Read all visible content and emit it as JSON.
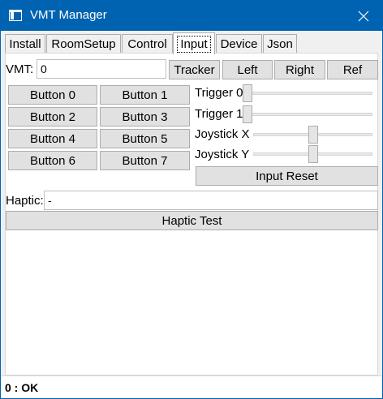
{
  "window": {
    "title": "VMT Manager"
  },
  "tabs": [
    {
      "label": "Install"
    },
    {
      "label": "RoomSetup"
    },
    {
      "label": "Control"
    },
    {
      "label": "Input"
    },
    {
      "label": "Device"
    },
    {
      "label": "Json"
    }
  ],
  "active_tab": "Input",
  "input": {
    "vmt_label": "VMT:",
    "vmt_value": "0",
    "mode_buttons": [
      "Tracker",
      "Left",
      "Right",
      "Ref"
    ],
    "buttons": [
      "Button 0",
      "Button 1",
      "Button 2",
      "Button 3",
      "Button 4",
      "Button 5",
      "Button 6",
      "Button 7"
    ],
    "sliders": [
      {
        "label": "Trigger 0",
        "value": 0.0
      },
      {
        "label": "Trigger 1",
        "value": 0.0
      },
      {
        "label": "Joystick X",
        "value": 0.5
      },
      {
        "label": "Joystick Y",
        "value": 0.5
      }
    ],
    "input_reset_label": "Input Reset",
    "haptic_label": "Haptic:",
    "haptic_value": "-",
    "haptic_test_label": "Haptic Test"
  },
  "status": {
    "text": "0 : OK"
  },
  "colors": {
    "accent": "#0063b1",
    "button_face": "#e1e1e1",
    "button_border": "#adadad",
    "window_bg": "#f0f0f0"
  }
}
